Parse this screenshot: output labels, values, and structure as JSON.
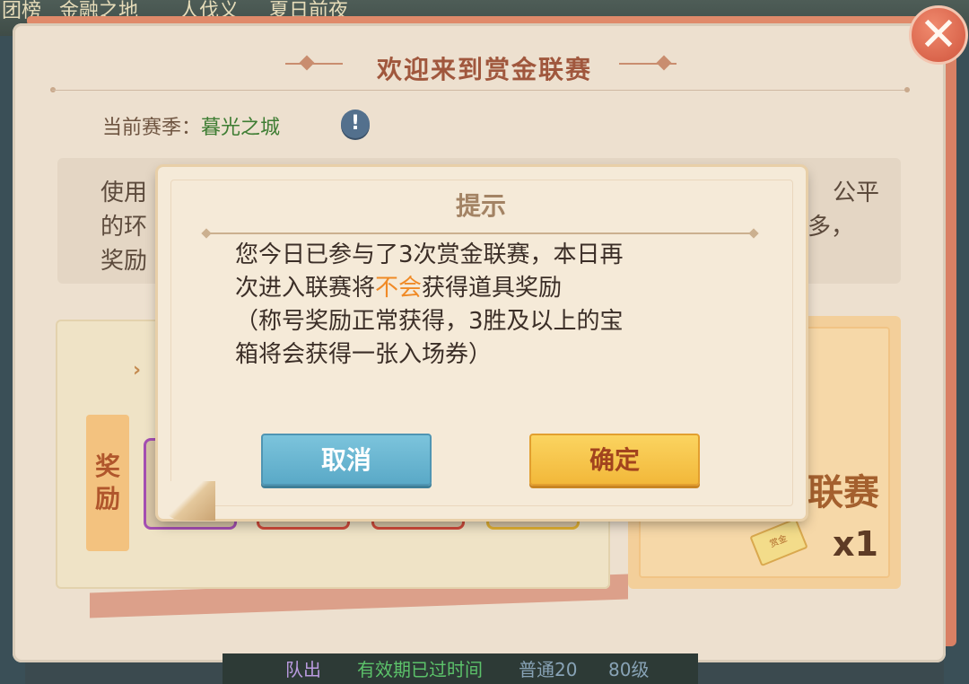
{
  "background": {
    "top_tabs": [
      "团榜",
      "金融之地",
      "人伐义",
      "夏日前夜"
    ],
    "bottom_text": [
      "队出",
      "有效期已过时间",
      "普通20",
      "80级"
    ]
  },
  "panel": {
    "title": "欢迎来到赏金联赛",
    "season_label": "当前赛季：",
    "season_value": "暮光之城",
    "info_icon_label": "!",
    "close_label": "✕",
    "description_left": [
      "使用",
      "的环",
      "奖励"
    ],
    "description_right": [
      "公平",
      "多，"
    ],
    "reward_tag": [
      "奖",
      "励"
    ],
    "ticket_name": "联赛",
    "ticket_count": "x1",
    "ticket_icon_label": "赏金"
  },
  "dialog": {
    "title": "提示",
    "message_line1": "您今日已参与了3次赏金联赛，本日再",
    "message_line2_pre": "次进入联赛将",
    "message_line2_highlight": "不会",
    "message_line2_post": "获得道具奖励",
    "message_line3": "（称号奖励正常获得，3胜及以上的宝",
    "message_line4": "箱将会获得一张入场券）",
    "cancel_label": "取消",
    "confirm_label": "确定"
  },
  "colors": {
    "highlight": "#f08a26",
    "title_brown": "#a0573d",
    "season_green": "#3e7d33",
    "cancel_blue": "#5aa9c7",
    "confirm_yellow": "#f2b83a"
  }
}
